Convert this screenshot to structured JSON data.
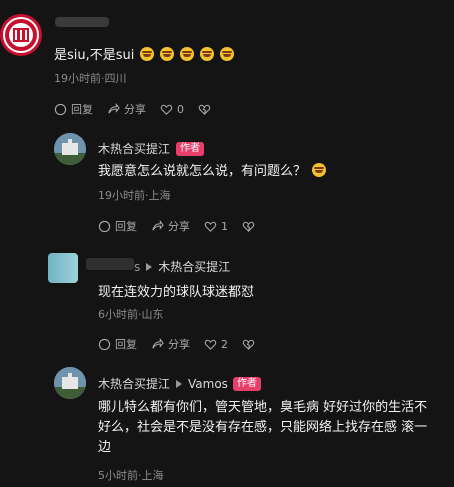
{
  "comment1": {
    "text": "是siu,不是sui",
    "meta": "19小时前·四川",
    "actions": {
      "reply": "回复",
      "share": "分享",
      "likes": "0"
    }
  },
  "reply1": {
    "user": "木热合买提江",
    "badge": "作者",
    "text": "我愿意怎么说就怎么说，有问题么？",
    "meta": "19小时前·上海",
    "actions": {
      "reply": "回复",
      "share": "分享",
      "likes": "1"
    }
  },
  "reply2": {
    "user_partial": "s",
    "reply_to": "木热合买提江",
    "text": "现在连效力的球队球迷都怼",
    "meta": "6小时前·山东",
    "actions": {
      "reply": "回复",
      "share": "分享",
      "likes": "2"
    }
  },
  "reply3": {
    "user": "木热合买提江",
    "reply_to": "Vamos",
    "badge": "作者",
    "text_line1": "哪儿特么都有你们，管天管地，臭毛病 好好过你的生活不",
    "text_line2": "好么，社会是不是没有存在感，只能网络上找存在感 滚一",
    "text_line3": "边",
    "meta": "5小时前·上海"
  },
  "colors": {
    "badge": "#e83e6a",
    "background": "#141414"
  }
}
